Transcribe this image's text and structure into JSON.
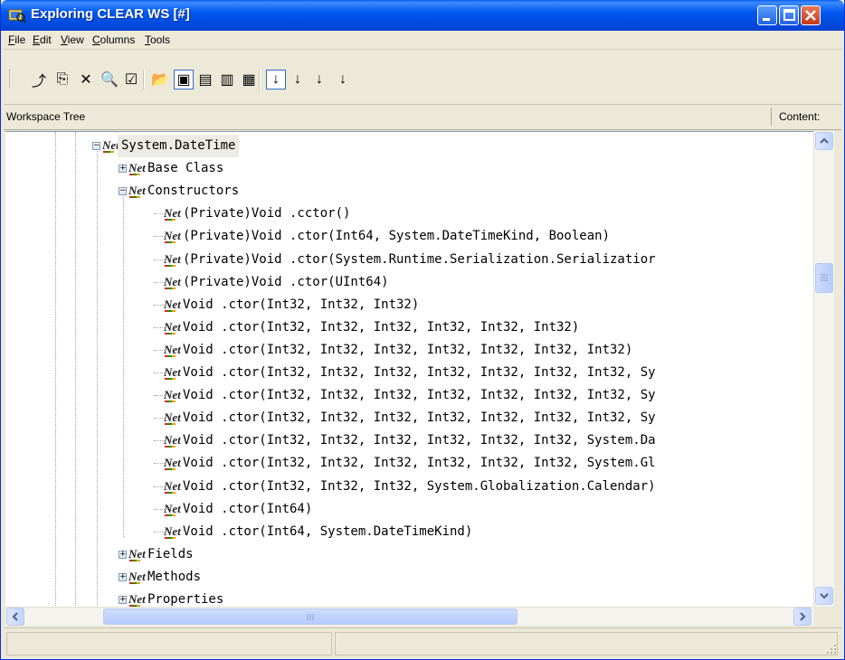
{
  "window": {
    "title": "Exploring CLEAR WS [#]"
  },
  "menu": [
    "File",
    "Edit",
    "View",
    "Columns",
    "Tools"
  ],
  "toolbar": {
    "buttons": [
      {
        "name": "up-folder-icon",
        "glyph": "⤴",
        "pressed": false
      },
      {
        "name": "copy-icon",
        "glyph": "⎘",
        "pressed": false
      },
      {
        "name": "delete-icon",
        "glyph": "✕",
        "pressed": false
      },
      {
        "name": "search-icon",
        "glyph": "🔍",
        "pressed": false
      },
      {
        "name": "properties-icon",
        "glyph": "☑",
        "pressed": false
      },
      {
        "name": "open-folder-icon",
        "glyph": "📂",
        "pressed": false
      },
      {
        "name": "large-icons-view-icon",
        "glyph": "▣",
        "pressed": true
      },
      {
        "name": "small-icons-view-icon",
        "glyph": "▤",
        "pressed": false
      },
      {
        "name": "list-view-icon",
        "glyph": "▥",
        "pressed": false
      },
      {
        "name": "details-view-icon",
        "glyph": "▦",
        "pressed": false
      },
      {
        "name": "sort-az-icon",
        "glyph": "↓",
        "pressed": true
      },
      {
        "name": "sort-za-icon",
        "glyph": "↓",
        "pressed": false
      },
      {
        "name": "sort-type-icon",
        "glyph": "↓",
        "pressed": false
      },
      {
        "name": "sort-size-icon",
        "glyph": "↓",
        "pressed": false
      }
    ]
  },
  "header": {
    "left": "Workspace Tree",
    "right": "Content:"
  },
  "tree": {
    "rows": [
      {
        "level": 0,
        "expander": "-",
        "label": "System.DateTime",
        "selected": true
      },
      {
        "level": 1,
        "expander": "+",
        "label": "Base Class"
      },
      {
        "level": 1,
        "expander": "-",
        "label": "Constructors"
      },
      {
        "level": 2,
        "expander": "",
        "label": "(Private)Void .cctor()"
      },
      {
        "level": 2,
        "expander": "",
        "label": "(Private)Void .ctor(Int64, System.DateTimeKind, Boolean)"
      },
      {
        "level": 2,
        "expander": "",
        "label": "(Private)Void .ctor(System.Runtime.Serialization.Serializatior"
      },
      {
        "level": 2,
        "expander": "",
        "label": "(Private)Void .ctor(UInt64)"
      },
      {
        "level": 2,
        "expander": "",
        "label": "Void .ctor(Int32, Int32, Int32)"
      },
      {
        "level": 2,
        "expander": "",
        "label": "Void .ctor(Int32, Int32, Int32, Int32, Int32, Int32)"
      },
      {
        "level": 2,
        "expander": "",
        "label": "Void .ctor(Int32, Int32, Int32, Int32, Int32, Int32, Int32)"
      },
      {
        "level": 2,
        "expander": "",
        "label": "Void .ctor(Int32, Int32, Int32, Int32, Int32, Int32, Int32, Sy"
      },
      {
        "level": 2,
        "expander": "",
        "label": "Void .ctor(Int32, Int32, Int32, Int32, Int32, Int32, Int32, Sy"
      },
      {
        "level": 2,
        "expander": "",
        "label": "Void .ctor(Int32, Int32, Int32, Int32, Int32, Int32, Int32, Sy"
      },
      {
        "level": 2,
        "expander": "",
        "label": "Void .ctor(Int32, Int32, Int32, Int32, Int32, Int32, System.Da"
      },
      {
        "level": 2,
        "expander": "",
        "label": "Void .ctor(Int32, Int32, Int32, Int32, Int32, Int32, System.Gl"
      },
      {
        "level": 2,
        "expander": "",
        "label": "Void .ctor(Int32, Int32, Int32, System.Globalization.Calendar)"
      },
      {
        "level": 2,
        "expander": "",
        "label": "Void .ctor(Int64)"
      },
      {
        "level": 2,
        "expander": "",
        "label": "Void .ctor(Int64, System.DateTimeKind)"
      },
      {
        "level": 1,
        "expander": "+",
        "label": "Fields"
      },
      {
        "level": 1,
        "expander": "+",
        "label": "Methods"
      },
      {
        "level": 1,
        "expander": "+",
        "label": "Properties"
      }
    ]
  },
  "icons": {
    "net": "Net"
  },
  "scrollbars": {
    "up": "▲",
    "down": "▼",
    "left": "◀",
    "right": "▶"
  }
}
